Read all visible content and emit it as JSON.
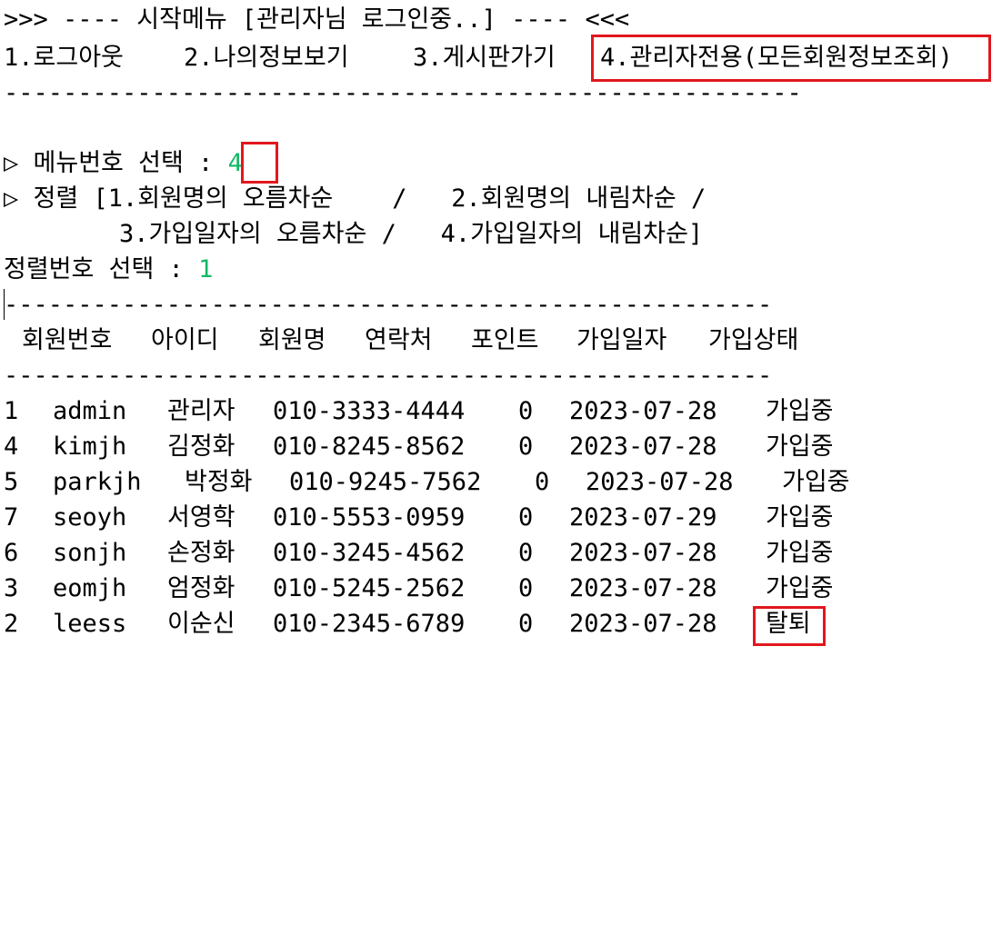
{
  "title_line": ">>> ---- 시작메뉴 [관리자님 로그인중..] ---- <<<",
  "menu": {
    "items": [
      "1.로그아웃",
      "2.나의정보보기",
      "3.게시판가기",
      "4.관리자전용(모든회원정보조회)"
    ],
    "divider": "------------------------------------------------------"
  },
  "menu_select": {
    "label": "▷ 메뉴번호 선택 : ",
    "value": "4"
  },
  "sort": {
    "line1": "▷ 정렬 [1.회원명의 오름차순    /   2.회원명의 내림차순 /",
    "line2": "3.가입일자의 오름차순 /   4.가입일자의 내림차순]",
    "label": "정렬번호 선택 : ",
    "value": "1"
  },
  "table": {
    "divider": "----------------------------------------------------",
    "columns": [
      "회원번호",
      "아이디",
      "회원명",
      "연락처",
      "포인트",
      "가입일자",
      "가입상태"
    ],
    "rows": [
      [
        "1",
        "admin",
        "관리자",
        "010-3333-4444",
        "0",
        "2023-07-28",
        "가입중"
      ],
      [
        "4",
        "kimjh",
        "김정화",
        "010-8245-8562",
        "0",
        "2023-07-28",
        "가입중"
      ],
      [
        "5",
        "parkjh",
        "박정화",
        "010-9245-7562",
        "0",
        "2023-07-28",
        "가입중"
      ],
      [
        "7",
        "seoyh",
        "서영학",
        "010-5553-0959",
        "0",
        "2023-07-29",
        "가입중"
      ],
      [
        "6",
        "sonjh",
        "손정화",
        "010-3245-4562",
        "0",
        "2023-07-28",
        "가입중"
      ],
      [
        "3",
        "eomjh",
        "엄정화",
        "010-5245-2562",
        "0",
        "2023-07-28",
        "가입중"
      ],
      [
        "2",
        "leess",
        "이순신",
        "010-2345-6789",
        "0",
        "2023-07-28",
        "탈퇴"
      ]
    ]
  },
  "colors": {
    "input_value": "#12b866",
    "highlight_box": "#e2171e"
  }
}
